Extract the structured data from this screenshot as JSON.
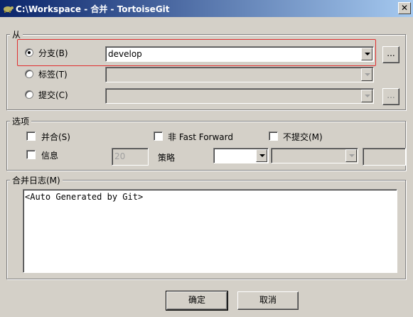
{
  "window": {
    "title": "C:\\Workspace - 合并 - TortoiseGit",
    "close_glyph": "✕"
  },
  "from_group": {
    "label": "从",
    "branch": {
      "label": "分支(B)",
      "value": "develop",
      "selected": true
    },
    "tag": {
      "label": "标签(T)",
      "value": ""
    },
    "commit": {
      "label": "提交(C)",
      "value": ""
    },
    "browse_label": "..."
  },
  "options_group": {
    "label": "选项",
    "squash_label": "并合(S)",
    "no_ff_label": "非 Fast Forward",
    "no_commit_label": "不提交(M)",
    "log_label": "信息",
    "log_count": "20",
    "strategy_label": "策略"
  },
  "merge_log": {
    "label": "合并日志(M)",
    "text": "<Auto Generated by Git>"
  },
  "buttons": {
    "ok": "确定",
    "cancel": "取消"
  },
  "colors": {
    "titlebar_start": "#0a246a",
    "titlebar_end": "#a6caf0",
    "highlight": "#e03030"
  }
}
